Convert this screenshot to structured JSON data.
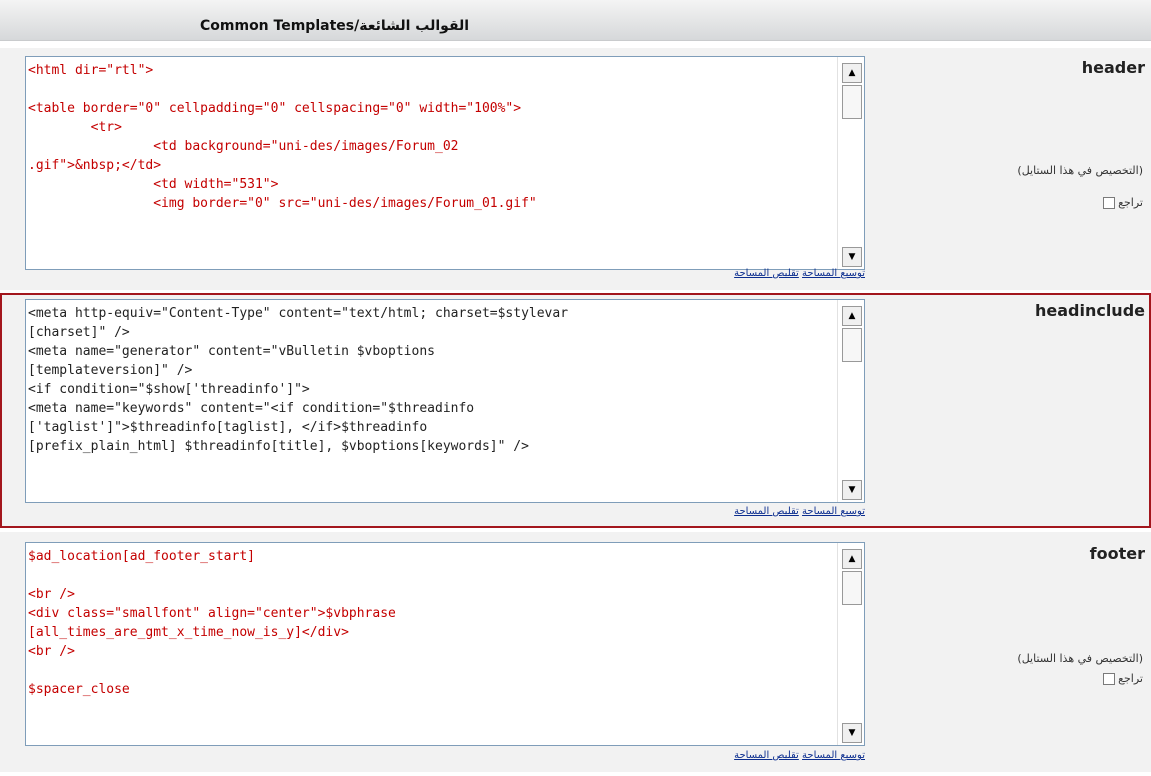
{
  "page_title": "Common Templates/القوالب الشائعة",
  "sections": [
    {
      "label": "header",
      "note": "(التخصيص في هذا الستايل)",
      "revert_label": "تراجع",
      "code": "<html dir=\"rtl\">\n\n<table border=\"0\" cellpadding=\"0\" cellspacing=\"0\" width=\"100%\">\n        <tr>\n                <td background=\"uni-des/images/Forum_02\n.gif\">&nbsp;</td>\n                <td width=\"531\">\n                <img border=\"0\" src=\"uni-des/images/Forum_01.gif\"",
      "expand_label": "توسيع المساحة",
      "shrink_label": "تقليص المساحة"
    },
    {
      "label": "headinclude",
      "code": "<meta http-equiv=\"Content-Type\" content=\"text/html; charset=$stylevar\n[charset]\" />\n<meta name=\"generator\" content=\"vBulletin $vboptions\n[templateversion]\" />\n<if condition=\"$show['threadinfo']\">\n<meta name=\"keywords\" content=\"<if condition=\"$threadinfo\n['taglist']\">$threadinfo[taglist], </if>$threadinfo\n[prefix_plain_html] $threadinfo[title], $vboptions[keywords]\" />",
      "expand_label": "توسيع المساحة",
      "shrink_label": "تقليص المساحة"
    },
    {
      "label": "footer",
      "note": "(التخصيص في هذا الستايل)",
      "revert_label": "تراجع",
      "code": "$ad_location[ad_footer_start]\n\n<br />\n<div class=\"smallfont\" align=\"center\">$vbphrase\n[all_times_are_gmt_x_time_now_is_y]</div>\n<br />\n\n$spacer_close",
      "expand_label": "توسيع المساحة",
      "shrink_label": "تقليص المساحة"
    }
  ],
  "colors": {
    "code_red": "#c40000",
    "code_dark": "#222222",
    "highlight_border": "#a3161d",
    "link_blue": "#0b2d8f"
  }
}
